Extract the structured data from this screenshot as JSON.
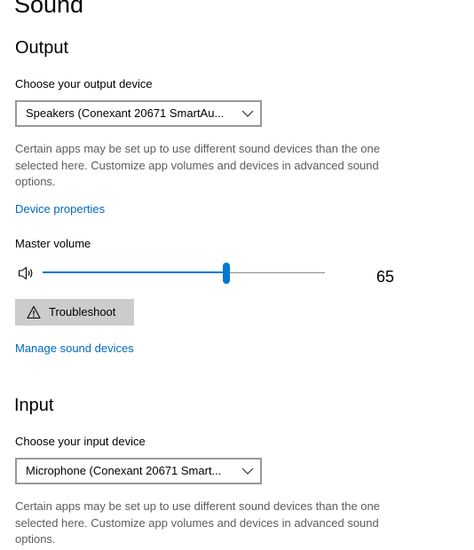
{
  "page": {
    "title": "Sound"
  },
  "output": {
    "heading": "Output",
    "device_label": "Choose your output device",
    "device_value": "Speakers (Conexant 20671 SmartAu...",
    "help_text": "Certain apps may be set up to use different sound devices than the one selected here. Customize app volumes and devices in advanced sound options.",
    "device_properties_link": "Device properties",
    "master_volume_label": "Master volume",
    "master_volume": 65,
    "master_volume_text": "65",
    "troubleshoot_label": "Troubleshoot",
    "manage_devices_link": "Manage sound devices"
  },
  "input": {
    "heading": "Input",
    "device_label": "Choose your input device",
    "device_value": "Microphone (Conexant 20671 Smart...",
    "help_text": "Certain apps may be set up to use different sound devices than the one selected here. Customize app volumes and devices in advanced sound options."
  },
  "icons": {
    "speaker": "speaker-icon",
    "warning": "warning-icon",
    "chevron": "chevron-down-icon"
  },
  "colors": {
    "accent": "#0078d4",
    "link": "#0067c0",
    "help_text": "#5c5c5c",
    "button_bg": "#cccccc",
    "dropdown_border": "#999999"
  }
}
